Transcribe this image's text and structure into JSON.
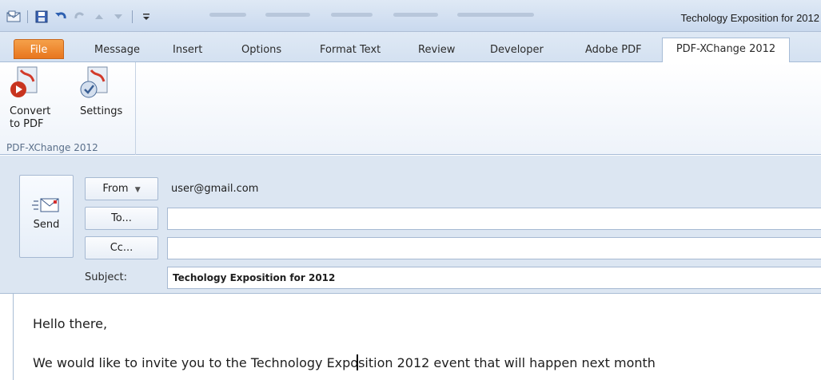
{
  "window": {
    "title": "Techology Exposition for 2012"
  },
  "tabs": [
    {
      "label": "File"
    },
    {
      "label": "Message"
    },
    {
      "label": "Insert"
    },
    {
      "label": "Options"
    },
    {
      "label": "Format Text"
    },
    {
      "label": "Review"
    },
    {
      "label": "Developer"
    },
    {
      "label": "Adobe PDF"
    },
    {
      "label": "PDF-XChange 2012"
    }
  ],
  "ribbon": {
    "group_label": "PDF-XChange 2012",
    "convert_label_1": "Convert",
    "convert_label_2": "to PDF",
    "settings_label": "Settings"
  },
  "compose": {
    "send_label": "Send",
    "from_label": "From",
    "from_value": "user@gmail.com",
    "to_label": "To...",
    "cc_label": "Cc...",
    "subject_label": "Subject:",
    "to_value": "",
    "cc_value": "",
    "subject_value": "Techology Exposition for 2012"
  },
  "body": {
    "line1": "Hello there,",
    "line2_before_caret": "We would like to invite you to the Technology Expo",
    "line2_after_caret": "sition 2012 event that will happen next month"
  },
  "colors": {
    "file_tab": "#e8761e",
    "chrome": "#dce6f2",
    "accent_border": "#a6b9d2"
  }
}
